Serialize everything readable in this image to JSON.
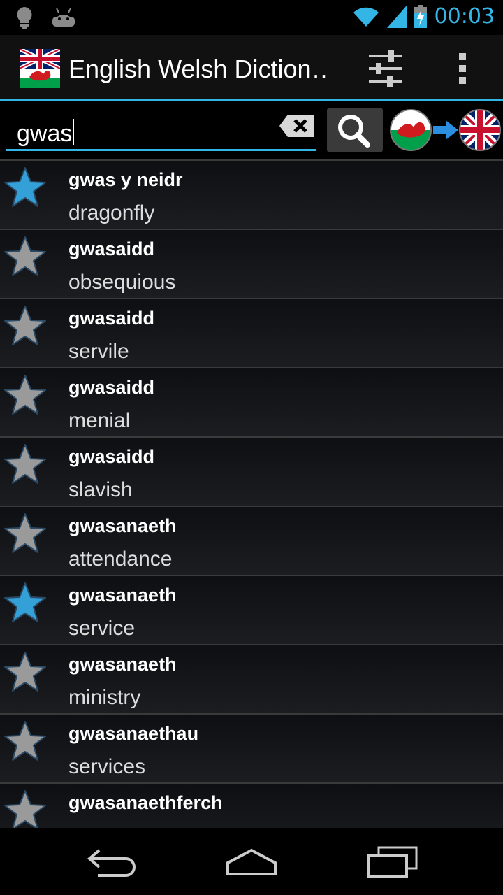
{
  "status_bar": {
    "clock": "00:03",
    "icons_left": [
      "lightbulb-icon",
      "android-icon"
    ],
    "icons_right": [
      "wifi-icon",
      "signal-icon",
      "battery-charging-icon"
    ],
    "accent": "#33b5e5"
  },
  "action_bar": {
    "title": "English Welsh Diction…",
    "app_icon": "uk-wales-flags-icon",
    "settings_icon": "sliders-icon",
    "overflow_icon": "overflow-menu-icon"
  },
  "search": {
    "value": "gwas",
    "clear_icon": "backspace-clear-icon",
    "search_icon": "magnifier-icon",
    "direction": {
      "from": "welsh-flag-icon",
      "arrow": "arrow-right-icon",
      "to": "uk-flag-icon"
    }
  },
  "results": [
    {
      "term": "gwas y neidr",
      "translation": "dragonfly",
      "favorite": true
    },
    {
      "term": "gwasaidd",
      "translation": "obsequious",
      "favorite": false
    },
    {
      "term": "gwasaidd",
      "translation": "servile",
      "favorite": false
    },
    {
      "term": "gwasaidd",
      "translation": "menial",
      "favorite": false
    },
    {
      "term": "gwasaidd",
      "translation": "slavish",
      "favorite": false
    },
    {
      "term": "gwasanaeth",
      "translation": "attendance",
      "favorite": false
    },
    {
      "term": "gwasanaeth",
      "translation": "service",
      "favorite": true
    },
    {
      "term": "gwasanaeth",
      "translation": "ministry",
      "favorite": false
    },
    {
      "term": "gwasanaethau",
      "translation": "services",
      "favorite": false
    },
    {
      "term": "gwasanaethferch",
      "translation": "",
      "favorite": false
    }
  ],
  "colors": {
    "favorite_star": "#33a1d8",
    "normal_star": "#9a9a9a"
  },
  "nav_bar": {
    "back_icon": "back-icon",
    "home_icon": "home-icon",
    "recents_icon": "recents-icon"
  }
}
